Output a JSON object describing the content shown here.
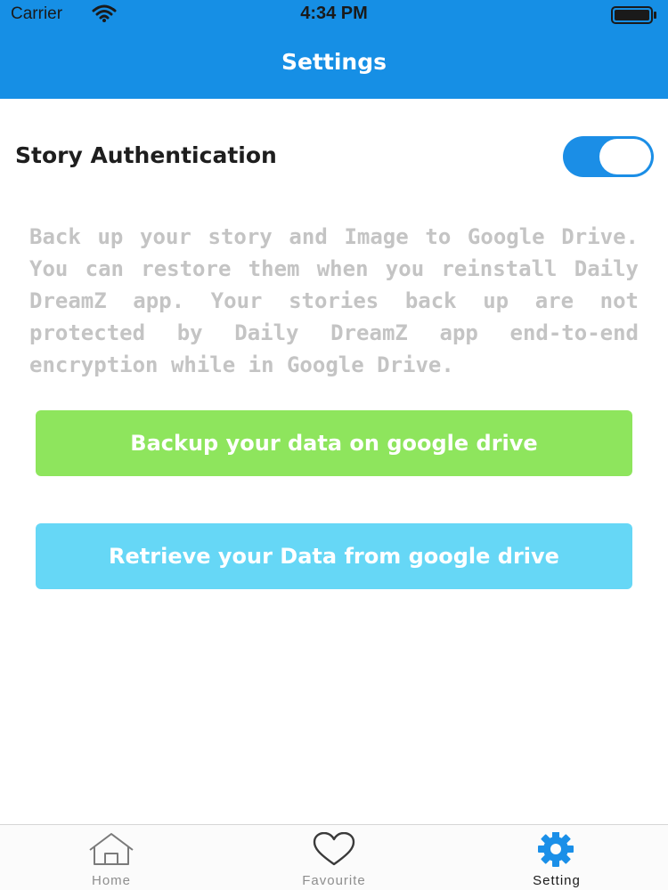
{
  "status_bar": {
    "carrier": "Carrier",
    "time": "4:34 PM"
  },
  "header": {
    "title": "Settings",
    "background_color": "#168fe5"
  },
  "settings": {
    "story_authentication": {
      "label": "Story Authentication",
      "enabled": true
    },
    "description": "Back up your story and Image to Google Drive. You can restore them when you reinstall Daily DreamZ app. Your stories back up are not protected by Daily DreamZ app end-to-end encryption while in Google Drive.",
    "backup_button": {
      "label": "Backup your data on google drive",
      "color": "#8ee55d"
    },
    "retrieve_button": {
      "label": "Retrieve your Data from google drive",
      "color": "#66d7f6"
    }
  },
  "tabbar": {
    "items": [
      {
        "label": "Home",
        "icon": "home-icon",
        "active": false
      },
      {
        "label": "Favourite",
        "icon": "heart-icon",
        "active": false
      },
      {
        "label": "Setting",
        "icon": "gear-icon",
        "active": true
      }
    ]
  }
}
